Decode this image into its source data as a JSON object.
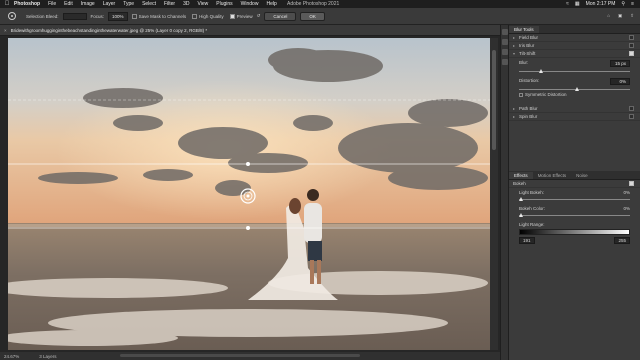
{
  "menubar": {
    "app": "Photoshop",
    "items": [
      "File",
      "Edit",
      "Image",
      "Layer",
      "Type",
      "Select",
      "Filter",
      "3D",
      "View",
      "Plugins",
      "Window",
      "Help"
    ],
    "center_title": "Adobe Photoshop 2021",
    "clock": "Mon 2:17 PM"
  },
  "options": {
    "selection_label": "Selection Bleed:",
    "focus_label": "Focus:",
    "focus_value": "100%",
    "save_mask_label": "Save Mask to Channels",
    "high_quality_label": "High Quality",
    "preview_label": "Preview",
    "cancel_label": "Cancel",
    "ok_label": "OK"
  },
  "document": {
    "tab_title": "Bridewithgroomhugginginthebeachstandinginthewaterwater.jpeg @ 25% (Layer 0 copy 2, RGB/8) *"
  },
  "status": {
    "zoom": "24.67%",
    "layers": "3 Layers"
  },
  "blur_tools": {
    "tab_label": "Blur Tools",
    "items": [
      {
        "label": "Field Blur",
        "checked": false
      },
      {
        "label": "Iris Blur",
        "checked": false
      },
      {
        "label": "Tilt-Shift",
        "checked": true
      }
    ],
    "blur_label": "Blur:",
    "blur_value": "15 px",
    "distortion_label": "Distortion:",
    "distortion_value": "0%",
    "symmetric_label": "Symmetric Distortion",
    "more_items": [
      {
        "label": "Path Blur",
        "checked": false
      },
      {
        "label": "Spin Blur",
        "checked": false
      }
    ]
  },
  "effects": {
    "tabs": [
      "Effects",
      "Motion Effects",
      "Noise"
    ],
    "bokeh_label": "Bokeh",
    "light_bokeh_label": "Light Bokeh:",
    "light_bokeh_value": "0%",
    "bokeh_color_label": "Bokeh Color:",
    "bokeh_color_value": "0%",
    "light_range_label": "Light Range:",
    "range_low": "191",
    "range_high": "255"
  }
}
